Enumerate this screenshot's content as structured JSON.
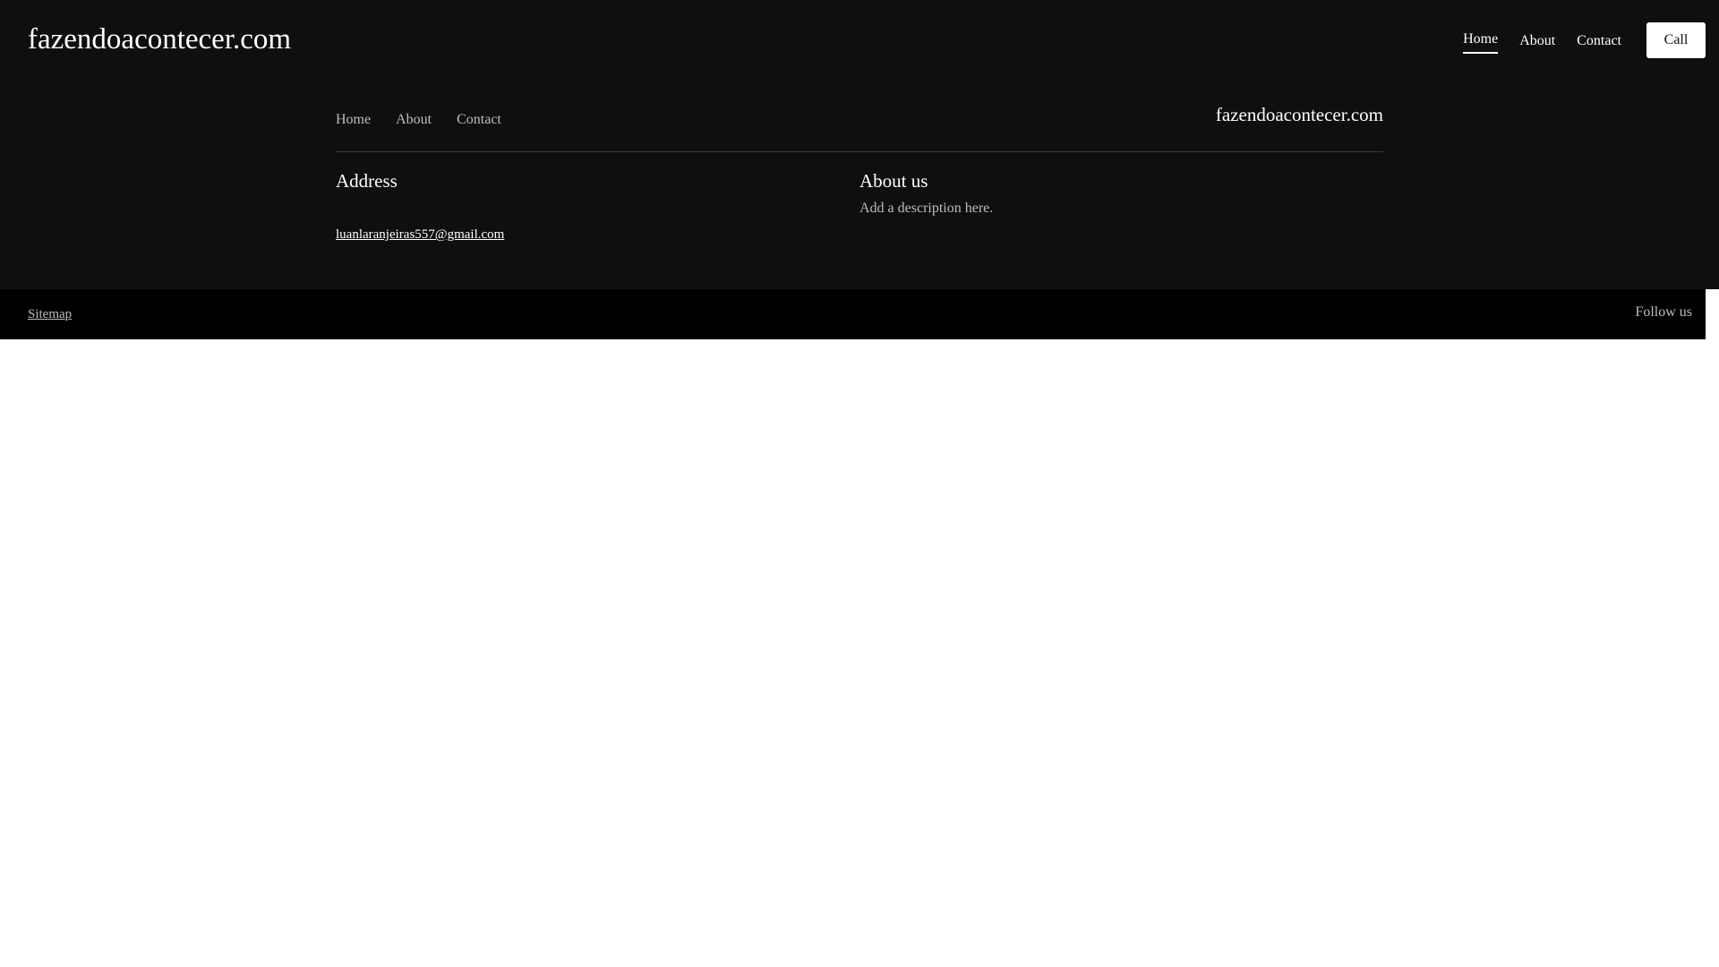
{
  "header": {
    "logo": "fazendoacontecer.com",
    "nav": [
      {
        "label": "Home",
        "active": true
      },
      {
        "label": "About",
        "active": false
      },
      {
        "label": "Contact",
        "active": false
      }
    ],
    "call_label": "Call"
  },
  "footer": {
    "nav": [
      {
        "label": "Home"
      },
      {
        "label": "About"
      },
      {
        "label": "Contact"
      }
    ],
    "brand": "fazendoacontecer.com",
    "address": {
      "heading": "Address",
      "email": "luanlaranjeiras557@gmail.com"
    },
    "about": {
      "heading": "About us",
      "description": "Add a description here."
    }
  },
  "bottom_bar": {
    "sitemap_label": "Sitemap",
    "follow_label": "Follow us"
  },
  "colors": {
    "dark_background": "#0f0f0f",
    "bottom_bar_background": "#000000",
    "text_primary": "#ffffff",
    "text_muted": "#bdbdbd"
  }
}
